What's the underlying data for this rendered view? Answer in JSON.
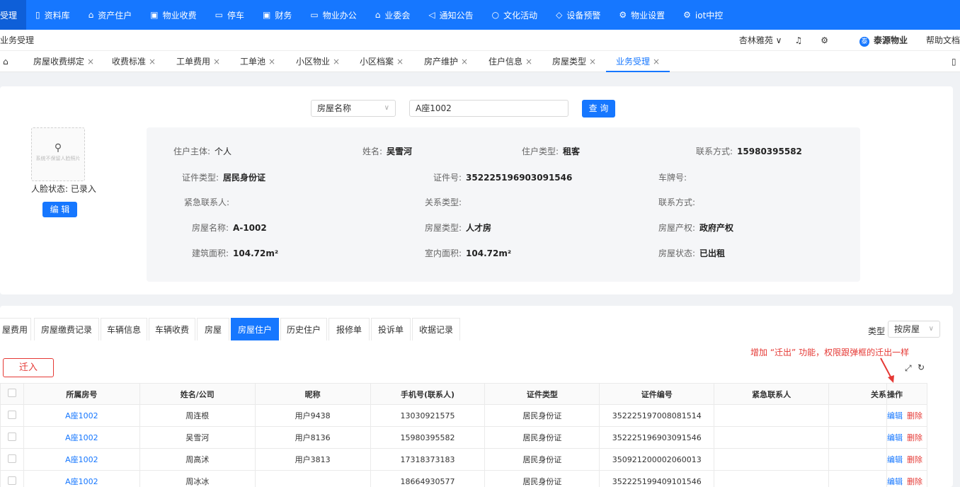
{
  "topnav": {
    "items": [
      {
        "label": "受理",
        "icon": ""
      },
      {
        "label": "资料库",
        "icon": "folder-icon"
      },
      {
        "label": "资产住户",
        "icon": "home-icon"
      },
      {
        "label": "物业收费",
        "icon": "bill-icon"
      },
      {
        "label": "停车",
        "icon": "car-icon"
      },
      {
        "label": "财务",
        "icon": "finance-icon"
      },
      {
        "label": "物业办公",
        "icon": "monitor-icon"
      },
      {
        "label": "业委会",
        "icon": "building-icon"
      },
      {
        "label": "通知公告",
        "icon": "megaphone-icon"
      },
      {
        "label": "文化活动",
        "icon": "activity-icon"
      },
      {
        "label": "设备预警",
        "icon": "alarm-icon"
      },
      {
        "label": "物业设置",
        "icon": "gear-icon"
      },
      {
        "label": "iot中控",
        "icon": "iot-icon"
      }
    ]
  },
  "header": {
    "breadcrumb": "业务受理",
    "community": "杏林雅苑 ∨",
    "company": "泰源物业",
    "help": "帮助文档"
  },
  "tabs": [
    {
      "label": "房屋收费绑定"
    },
    {
      "label": "收费标准"
    },
    {
      "label": "工单费用"
    },
    {
      "label": "工单池"
    },
    {
      "label": "小区物业"
    },
    {
      "label": "小区档案"
    },
    {
      "label": "房产维护"
    },
    {
      "label": "住户信息"
    },
    {
      "label": "房屋类型"
    },
    {
      "label": "业务受理"
    }
  ],
  "search": {
    "type": "房屋名称",
    "value": "A座1002",
    "button": "查 询"
  },
  "face": {
    "hint": "系统不保留人脸照片",
    "status": "人脸状态: 已录入",
    "edit": "编 辑"
  },
  "info": {
    "owner_type_k": "住户主体:",
    "owner_type_v": "个人",
    "name_k": "姓名:",
    "name_v": "吴雪河",
    "resident_type_k": "住户类型:",
    "resident_type_v": "租客",
    "contact_k": "联系方式:",
    "contact_v": "15980395582",
    "id_type_k": "证件类型:",
    "id_type_v": "居民身份证",
    "id_no_k": "证件号:",
    "id_no_v": "352225196903091546",
    "plate_k": "车牌号:",
    "plate_v": "",
    "emergency_k": "紧急联系人:",
    "emergency_v": "",
    "relation_k": "关系类型:",
    "relation_v": "",
    "contact2_k": "联系方式:",
    "contact2_v": "",
    "house_name_k": "房屋名称:",
    "house_name_v": "A-1002",
    "house_type_k": "房屋类型:",
    "house_type_v": "人才房",
    "ownership_k": "房屋产权:",
    "ownership_v": "政府产权",
    "area_k": "建筑面积:",
    "area_v": "104.72m²",
    "inner_area_k": "室内面积:",
    "inner_area_v": "104.72m²",
    "status_k": "房屋状态:",
    "status_v": "已出租"
  },
  "subtabs": [
    "屋费用",
    "房屋缴费记录",
    "车辆信息",
    "车辆收费",
    "房屋",
    "房屋住户",
    "历史住户",
    "报修单",
    "投诉单",
    "收据记录"
  ],
  "type_filter": {
    "label": "类型",
    "value": "按房屋"
  },
  "move_in": "迁入",
  "annotation": "增加 “迁出” 功能，权限跟弹框的迁出一样",
  "table": {
    "headers": [
      "所属房号",
      "姓名/公司",
      "昵称",
      "手机号(联系人)",
      "证件类型",
      "证件编号",
      "紧急联系人",
      "关系",
      "操作"
    ],
    "rows": [
      [
        "A座1002",
        "周连根",
        "用户9438",
        "13030921575",
        "居民身份证",
        "352225197008081514",
        "",
        ""
      ],
      [
        "A座1002",
        "吴雪河",
        "用户8136",
        "15980395582",
        "居民身份证",
        "352225196903091546",
        "",
        ""
      ],
      [
        "A座1002",
        "周高沭",
        "用户3813",
        "17318373183",
        "居民身份证",
        "350921200002060013",
        "",
        ""
      ],
      [
        "A座1002",
        "周冰冰",
        "",
        "18664930577",
        "居民身份证",
        "352225199409101546",
        "",
        ""
      ]
    ],
    "edit": "编辑",
    "delete": "删除"
  }
}
